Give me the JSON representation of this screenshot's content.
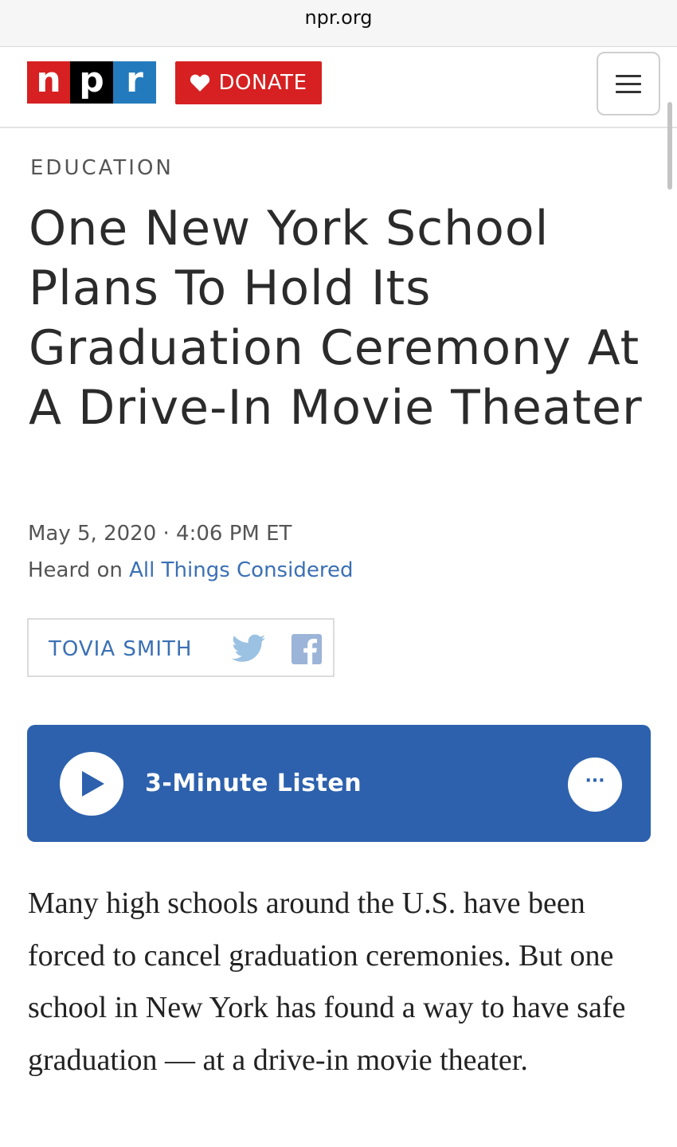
{
  "browser": {
    "url": "npr.org"
  },
  "header": {
    "logo_letters": [
      "n",
      "p",
      "r"
    ],
    "donate_label": "DONATE",
    "brand_colors": {
      "red": "#d62021",
      "black": "#000000",
      "blue": "#237bbd"
    }
  },
  "article": {
    "section": "EDUCATION",
    "headline": "One New York School Plans To Hold Its Graduation Ceremony At A Drive-In Movie Theater",
    "dateline": "May 5, 2020 · 4:06 PM ET",
    "heard_on_prefix": "Heard on ",
    "program": "All Things Considered",
    "author": "TOVIA SMITH",
    "body": "Many high schools around the U.S. have been forced to cancel graduation ceremonies. But one school in New York has found a way to have safe graduation — at a drive-in movie theater."
  },
  "player": {
    "label": "3-Minute Listen",
    "more_label": "···",
    "accent": "#2d61ad"
  },
  "icons": {
    "play": "play-icon",
    "twitter": "twitter-icon",
    "facebook": "facebook-icon",
    "menu": "hamburger-menu-icon",
    "heart": "heart-icon"
  }
}
